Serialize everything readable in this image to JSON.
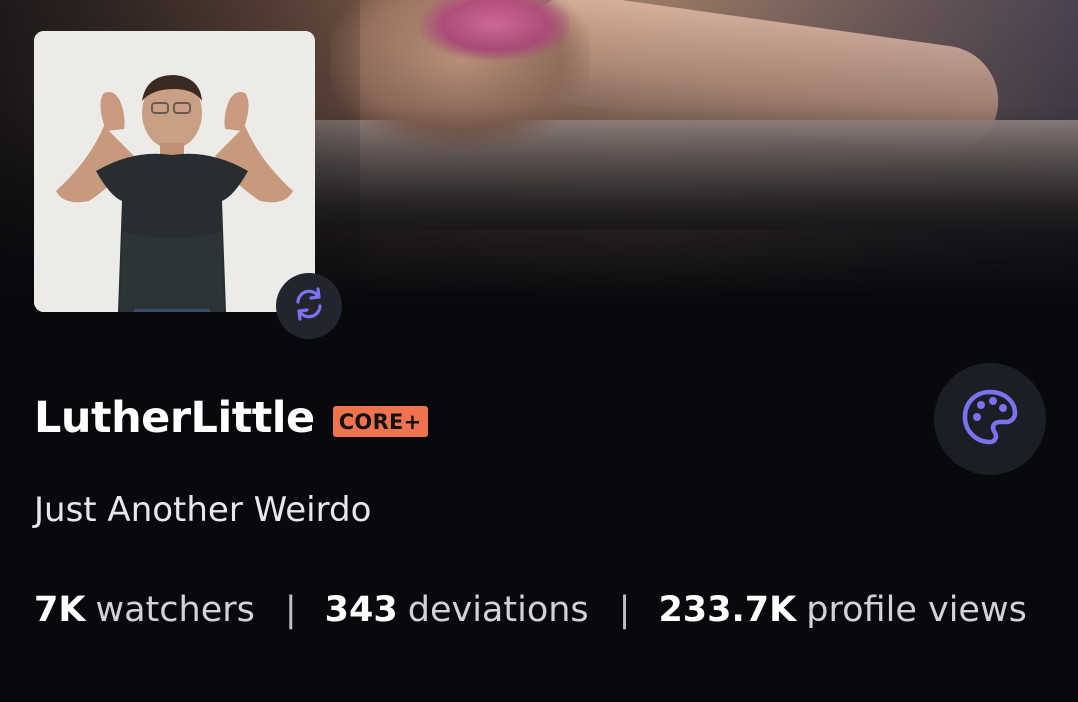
{
  "profile": {
    "username": "LutherLittle",
    "badge": "CORE+",
    "tagline": "Just Another Weirdo"
  },
  "stats": [
    {
      "value": "7K",
      "label": "watchers"
    },
    {
      "value": "343",
      "label": "deviations"
    },
    {
      "value": "233.7K",
      "label": "profile views"
    }
  ],
  "stats_separator": "|",
  "icons": {
    "avatar_action": "refresh-icon",
    "theme_action": "palette-icon"
  },
  "colors": {
    "background": "#08090d",
    "badge": "#f0734f",
    "icon_accent": "#7b72ef",
    "button_bg": "#1c1e26"
  }
}
